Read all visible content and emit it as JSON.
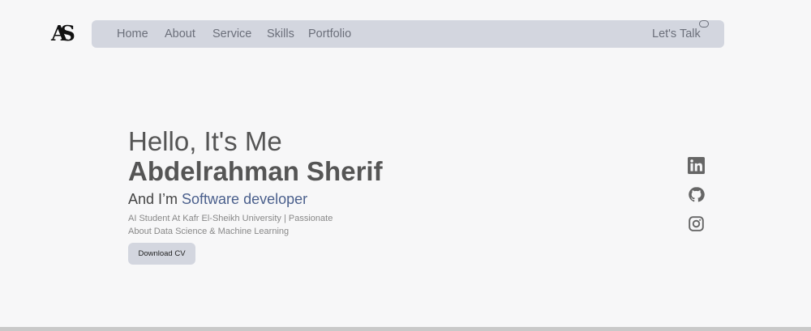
{
  "logo": "AS",
  "nav": {
    "items": [
      "Home",
      "About",
      "Service",
      "Skills",
      "Portfolio"
    ],
    "cta": "Let's Talk"
  },
  "hero": {
    "greeting": "Hello, It's Me",
    "name": "Abdelrahman Sherif",
    "role_prefix": "And I’m ",
    "role": "Software developer",
    "description_line1": "AI Student At Kafr El-Sheikh University | Passionate",
    "description_line2": "About Data Science & Machine Learning",
    "button": "Download CV"
  },
  "social": [
    "linkedin-icon",
    "github-icon",
    "instagram-icon"
  ]
}
